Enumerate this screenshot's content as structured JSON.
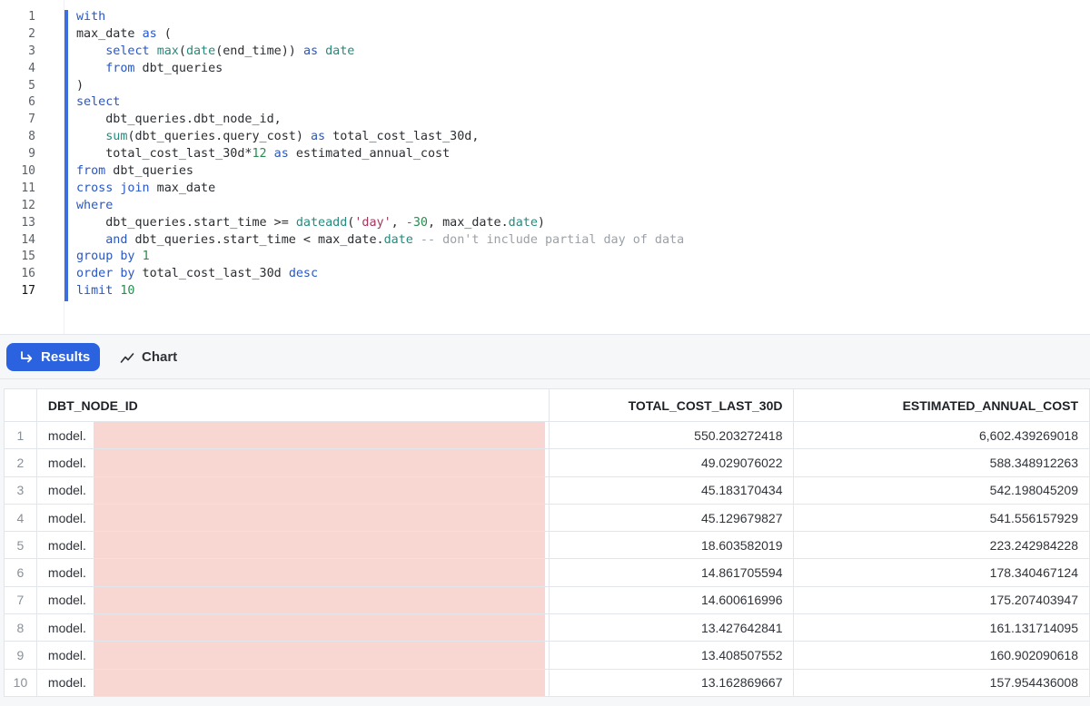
{
  "editor": {
    "line_numbers": [
      "1",
      "2",
      "3",
      "4",
      "5",
      "6",
      "7",
      "8",
      "9",
      "10",
      "11",
      "12",
      "13",
      "14",
      "15",
      "16",
      "17"
    ],
    "active_line": 17,
    "code_lines": [
      [
        {
          "t": "with",
          "c": "kw"
        }
      ],
      [
        {
          "t": "max_date ",
          "c": "id"
        },
        {
          "t": "as",
          "c": "kw"
        },
        {
          "t": " (",
          "c": "id"
        }
      ],
      [
        {
          "t": "    ",
          "c": "id"
        },
        {
          "t": "select",
          "c": "kw"
        },
        {
          "t": " ",
          "c": "id"
        },
        {
          "t": "max",
          "c": "fn"
        },
        {
          "t": "(",
          "c": "id"
        },
        {
          "t": "date",
          "c": "fn"
        },
        {
          "t": "(end_time)) ",
          "c": "id"
        },
        {
          "t": "as",
          "c": "kw"
        },
        {
          "t": " ",
          "c": "id"
        },
        {
          "t": "date",
          "c": "fn"
        }
      ],
      [
        {
          "t": "    ",
          "c": "id"
        },
        {
          "t": "from",
          "c": "kw"
        },
        {
          "t": " dbt_queries",
          "c": "id"
        }
      ],
      [
        {
          "t": ")",
          "c": "id"
        }
      ],
      [
        {
          "t": "select",
          "c": "kw"
        }
      ],
      [
        {
          "t": "    dbt_queries.dbt_node_id,",
          "c": "id"
        }
      ],
      [
        {
          "t": "    ",
          "c": "id"
        },
        {
          "t": "sum",
          "c": "fn"
        },
        {
          "t": "(dbt_queries.query_cost) ",
          "c": "id"
        },
        {
          "t": "as",
          "c": "kw"
        },
        {
          "t": " total_cost_last_30d,",
          "c": "id"
        }
      ],
      [
        {
          "t": "    total_cost_last_30d*",
          "c": "id"
        },
        {
          "t": "12",
          "c": "num"
        },
        {
          "t": " ",
          "c": "id"
        },
        {
          "t": "as",
          "c": "kw"
        },
        {
          "t": " estimated_annual_cost",
          "c": "id"
        }
      ],
      [
        {
          "t": "from",
          "c": "kw"
        },
        {
          "t": " dbt_queries",
          "c": "id"
        }
      ],
      [
        {
          "t": "cross join",
          "c": "kw"
        },
        {
          "t": " max_date",
          "c": "id"
        }
      ],
      [
        {
          "t": "where",
          "c": "kw"
        }
      ],
      [
        {
          "t": "    dbt_queries.start_time >= ",
          "c": "id"
        },
        {
          "t": "dateadd",
          "c": "fn"
        },
        {
          "t": "(",
          "c": "id"
        },
        {
          "t": "'day'",
          "c": "str"
        },
        {
          "t": ", ",
          "c": "id"
        },
        {
          "t": "-30",
          "c": "num"
        },
        {
          "t": ", max_date.",
          "c": "id"
        },
        {
          "t": "date",
          "c": "fn"
        },
        {
          "t": ")",
          "c": "id"
        }
      ],
      [
        {
          "t": "    ",
          "c": "id"
        },
        {
          "t": "and",
          "c": "kw"
        },
        {
          "t": " dbt_queries.start_time < max_date.",
          "c": "id"
        },
        {
          "t": "date",
          "c": "fn"
        },
        {
          "t": " -- don't include partial day of data",
          "c": "cm"
        }
      ],
      [
        {
          "t": "group by",
          "c": "kw"
        },
        {
          "t": " ",
          "c": "id"
        },
        {
          "t": "1",
          "c": "num"
        }
      ],
      [
        {
          "t": "order by",
          "c": "kw"
        },
        {
          "t": " total_cost_last_30d ",
          "c": "id"
        },
        {
          "t": "desc",
          "c": "kw"
        }
      ],
      [
        {
          "t": "limit",
          "c": "kw"
        },
        {
          "t": " ",
          "c": "id"
        },
        {
          "t": "10",
          "c": "num"
        }
      ]
    ]
  },
  "tabs": {
    "results_label": "Results",
    "results_icon": "return-arrow-icon",
    "chart_label": "Chart",
    "chart_icon": "line-chart-icon",
    "active": "Results",
    "accent_color": "#2a62df"
  },
  "table": {
    "headers": [
      "DBT_NODE_ID",
      "TOTAL_COST_LAST_30D",
      "ESTIMATED_ANNUAL_COST"
    ],
    "rows": [
      {
        "n": "1",
        "id": "model.",
        "cost": "550.203272418",
        "annual": "6,602.439269018"
      },
      {
        "n": "2",
        "id": "model.",
        "cost": "49.029076022",
        "annual": "588.348912263"
      },
      {
        "n": "3",
        "id": "model.",
        "cost": "45.183170434",
        "annual": "542.198045209"
      },
      {
        "n": "4",
        "id": "model.",
        "cost": "45.129679827",
        "annual": "541.556157929"
      },
      {
        "n": "5",
        "id": "model.",
        "cost": "18.603582019",
        "annual": "223.242984228"
      },
      {
        "n": "6",
        "id": "model.",
        "cost": "14.861705594",
        "annual": "178.340467124"
      },
      {
        "n": "7",
        "id": "model.",
        "cost": "14.600616996",
        "annual": "175.207403947"
      },
      {
        "n": "8",
        "id": "model.",
        "cost": "13.427642841",
        "annual": "161.131714095"
      },
      {
        "n": "9",
        "id": "model.",
        "cost": "13.408507552",
        "annual": "160.902090618"
      },
      {
        "n": "10",
        "id": "model.",
        "cost": "13.162869667",
        "annual": "157.954436008"
      }
    ],
    "redaction_color": "#f8d7d3"
  }
}
